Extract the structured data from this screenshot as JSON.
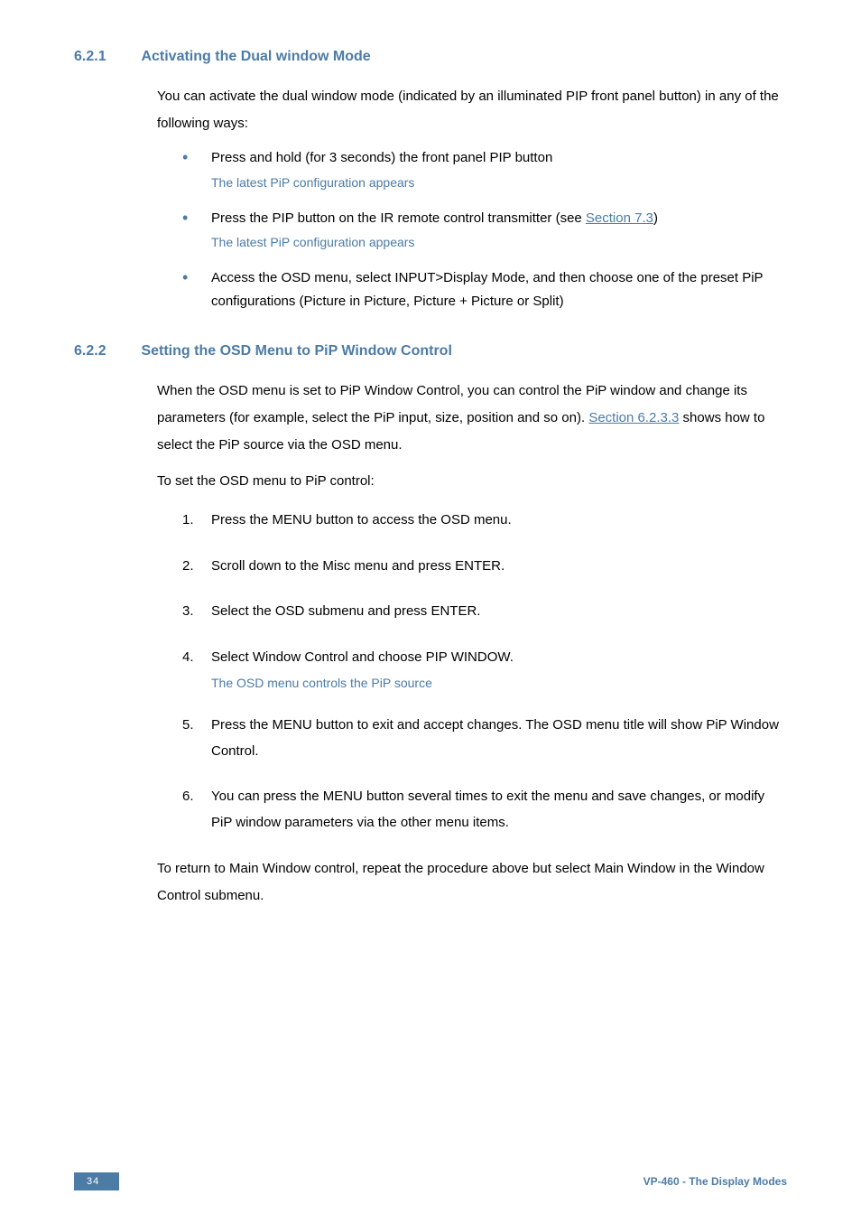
{
  "section1": {
    "num": "6.2.1",
    "title": "Activating the Dual window Mode",
    "intro": "You can activate the dual window mode (indicated by an illuminated PIP front panel button) in any of the following ways:",
    "bullets": [
      {
        "text": "Press and hold (for 3 seconds) the front panel PIP button",
        "note": "The latest PiP configuration appears"
      },
      {
        "text_pre": "Press the PIP button on the IR remote control transmitter (see ",
        "link": "Section 7.3",
        "text_post": ")",
        "note": "The latest PiP configuration appears"
      },
      {
        "text": "Access the OSD menu, select INPUT>Display Mode, and then choose one of the preset PiP configurations (Picture in Picture, Picture + Picture or Split)"
      }
    ]
  },
  "section2": {
    "num": "6.2.2",
    "title": "Setting the OSD Menu to PiP Window Control",
    "para1_pre": "When the OSD menu is set to PiP Window Control, you can control the PiP window and change its parameters (for example, select the PiP input, size, position and so on). ",
    "para1_link": "Section 6.2.3.3",
    "para1_post": " shows how to select the PiP source via the OSD menu.",
    "para2": "To set the OSD menu to PiP control:",
    "steps": [
      {
        "text": "Press the MENU button to access the OSD menu."
      },
      {
        "text": "Scroll down to the Misc menu and press ENTER."
      },
      {
        "text": "Select the OSD submenu and press ENTER."
      },
      {
        "text": "Select Window Control and choose PIP WINDOW.",
        "note": "The OSD menu controls the PiP source"
      },
      {
        "text": "Press the MENU button to exit and accept changes. The OSD menu title will show PiP Window Control."
      },
      {
        "text": "You can press the MENU button several times to exit the menu and save changes, or modify PiP window parameters via the other menu items."
      }
    ],
    "closing": "To return to Main Window control, repeat the procedure above but select Main Window in the Window Control submenu."
  },
  "footer": {
    "page": "34",
    "right": "VP-460 - The Display Modes"
  }
}
